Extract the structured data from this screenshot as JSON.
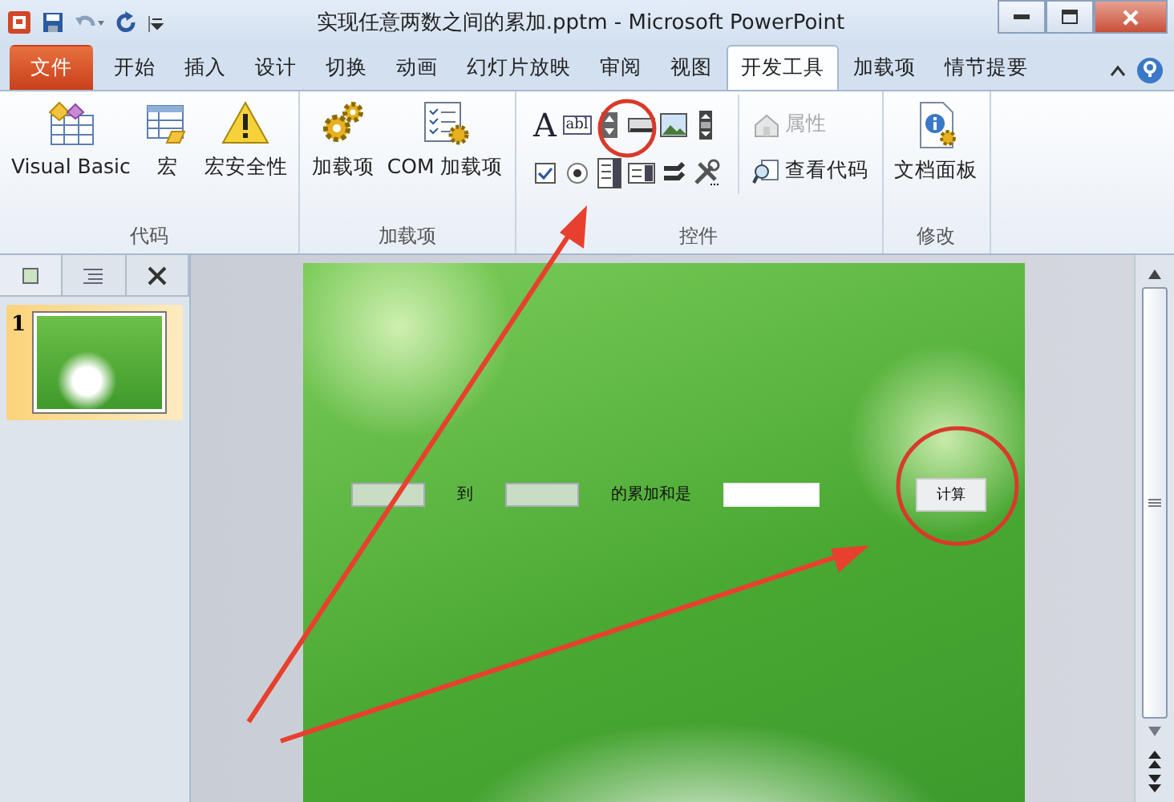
{
  "window": {
    "title": "实现任意两数之间的累加.pptm  -  Microsoft PowerPoint"
  },
  "tabs": [
    {
      "label": "文件",
      "kind": "file",
      "selected": false
    },
    {
      "label": "开始",
      "kind": "tab",
      "selected": false
    },
    {
      "label": "插入",
      "kind": "tab",
      "selected": false
    },
    {
      "label": "设计",
      "kind": "tab",
      "selected": false
    },
    {
      "label": "切换",
      "kind": "tab",
      "selected": false
    },
    {
      "label": "动画",
      "kind": "tab",
      "selected": false
    },
    {
      "label": "幻灯片放映",
      "kind": "tab",
      "selected": false
    },
    {
      "label": "审阅",
      "kind": "tab",
      "selected": false
    },
    {
      "label": "视图",
      "kind": "tab",
      "selected": false
    },
    {
      "label": "开发工具",
      "kind": "tab",
      "selected": true
    },
    {
      "label": "加载项",
      "kind": "tab",
      "selected": false
    },
    {
      "label": "情节提要",
      "kind": "tab",
      "selected": false
    }
  ],
  "ribbon": {
    "groups": [
      {
        "label": "代码",
        "kind": "large",
        "buttons": [
          {
            "label": "Visual Basic",
            "kind": "vb"
          },
          {
            "label": "宏",
            "kind": "macro"
          },
          {
            "label": "宏安全性",
            "kind": "warning"
          }
        ]
      },
      {
        "label": "加载项",
        "kind": "large",
        "buttons": [
          {
            "label": "加载项",
            "kind": "gears"
          },
          {
            "label": "COM 加载项",
            "kind": "com"
          }
        ]
      },
      {
        "label": "控件",
        "kind": "controls",
        "controls": [
          {
            "kind": "label",
            "glyph": "A"
          },
          {
            "kind": "textbox",
            "glyph": "abl"
          },
          {
            "kind": "spin"
          },
          {
            "kind": "button"
          },
          {
            "kind": "image"
          },
          {
            "kind": "scroll"
          },
          {
            "kind": "checkbox"
          },
          {
            "kind": "option"
          },
          {
            "kind": "list"
          },
          {
            "kind": "combo"
          },
          {
            "kind": "toggle"
          },
          {
            "kind": "more"
          }
        ],
        "buttons": [
          {
            "label": "属性",
            "kind": "props",
            "disabled": true
          },
          {
            "label": "查看代码",
            "kind": "code",
            "disabled": false
          }
        ]
      },
      {
        "label": "修改",
        "kind": "large",
        "buttons": [
          {
            "label": "文档面板",
            "kind": "docpanel"
          }
        ]
      }
    ]
  },
  "slides_pane": {
    "thumbnails": [
      {
        "number": "1",
        "selected": true
      }
    ]
  },
  "slide": {
    "items": [
      {
        "kind": "textbox",
        "disabled": true
      },
      {
        "kind": "label",
        "text": "到"
      },
      {
        "kind": "textbox",
        "disabled": true
      },
      {
        "kind": "label",
        "text": "的累加和是"
      },
      {
        "kind": "textbox",
        "disabled": false
      },
      {
        "kind": "button",
        "text": "计算"
      }
    ]
  }
}
